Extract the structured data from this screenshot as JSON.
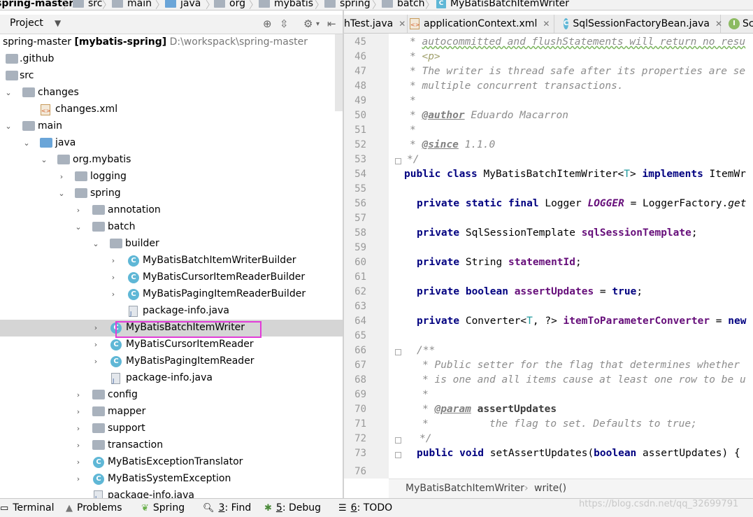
{
  "breadcrumb": [
    "spring-master",
    "src",
    "main",
    "java",
    "org",
    "mybatis",
    "spring",
    "batch",
    "MyBatisBatchItemWriter"
  ],
  "project_panel": {
    "title": "Project"
  },
  "tree": [
    {
      "label": "spring-master",
      "bold_suffix": "[mybatis-spring]",
      "path": "D:\\workspack\\spring-master",
      "type": "module"
    },
    {
      "label": ".github",
      "type": "folder"
    },
    {
      "label": "src",
      "type": "folder"
    },
    {
      "label": "changes",
      "type": "folder"
    },
    {
      "label": "changes.xml",
      "type": "xml"
    },
    {
      "label": "main",
      "type": "folder"
    },
    {
      "label": "java",
      "type": "folder-blue"
    },
    {
      "label": "org.mybatis",
      "type": "folder"
    },
    {
      "label": "logging",
      "type": "folder"
    },
    {
      "label": "spring",
      "type": "folder"
    },
    {
      "label": "annotation",
      "type": "folder"
    },
    {
      "label": "batch",
      "type": "folder"
    },
    {
      "label": "builder",
      "type": "folder"
    },
    {
      "label": "MyBatisBatchItemWriterBuilder",
      "type": "class"
    },
    {
      "label": "MyBatisCursorItemReaderBuilder",
      "type": "class"
    },
    {
      "label": "MyBatisPagingItemReaderBuilder",
      "type": "class"
    },
    {
      "label": "package-info.java",
      "type": "file"
    },
    {
      "label": "MyBatisBatchItemWriter",
      "type": "class"
    },
    {
      "label": "MyBatisCursorItemReader",
      "type": "class"
    },
    {
      "label": "MyBatisPagingItemReader",
      "type": "class"
    },
    {
      "label": "package-info.java",
      "type": "file"
    },
    {
      "label": "config",
      "type": "folder"
    },
    {
      "label": "mapper",
      "type": "folder"
    },
    {
      "label": "support",
      "type": "folder"
    },
    {
      "label": "transaction",
      "type": "folder"
    },
    {
      "label": "MyBatisExceptionTranslator",
      "type": "class"
    },
    {
      "label": "MyBatisSystemException",
      "type": "class"
    },
    {
      "label": "package-info.java",
      "type": "file"
    }
  ],
  "tabs": [
    "hTest.java",
    "applicationContext.xml",
    "SqlSessionFactoryBean.java",
    "Sc"
  ],
  "line_numbers": [
    "45",
    "46",
    "47",
    "48",
    "49",
    "50",
    "51",
    "52",
    "53",
    "54",
    "55",
    "56",
    "57",
    "58",
    "59",
    "60",
    "61",
    "62",
    "63",
    "64",
    "65",
    "66",
    "67",
    "68",
    "69",
    "70",
    "71",
    "72",
    "73",
    "76"
  ],
  "code": {
    "l45": "autocommitted and flushStatements will return no resu",
    "l46": "<p>",
    "l47": "The writer is thread safe after its properties are se",
    "l48": "multiple concurrent transactions.",
    "l50_tag": "@author",
    "l50_text": "Eduardo Macarron",
    "l52_tag": "@since",
    "l52_text": "1.1.0",
    "l54_kw": "public class",
    "l54_name": "MyBatisBatchItemWriter<",
    "l54_t": "T",
    "l54_rest": "> ",
    "l54_kw2": "implements",
    "l54_tail": "ItemWr",
    "l56_kw": "private static final",
    "l56_type": "Logger",
    "l56_field": "LOGGER",
    "l56_rest": "= LoggerFactory.",
    "l56_tail": "get",
    "l58_kw": "private",
    "l58_type": "SqlSessionTemplate",
    "l58_field": "sqlSessionTemplate",
    "l60_type": "String",
    "l60_field": "statementId",
    "l62_kw": "private boolean",
    "l62_field": "assertUpdates",
    "l62_rest": "= ",
    "l62_true": "true",
    "l64_type": "Converter<",
    "l64_t": "T",
    "l64_rest": ", ?>",
    "l64_field": "itemToParameterConverter",
    "l64_eq": "= ",
    "l64_new": "new",
    "l66": "/**",
    "l67": "* Public setter for the flag that determines whether",
    "l68": "* is one and all items cause at least one row to be u",
    "l69": "*",
    "l70_tag": "@param",
    "l70_name": "assertUpdates",
    "l71": "the flag to set. Defaults to true;",
    "l72": "*/",
    "l73_kw": "public void",
    "l73_name": "setAssertUpdates(",
    "l73_kw2": "boolean",
    "l73_rest": "assertUpdates) {"
  },
  "editor_breadcrumb": [
    "MyBatisBatchItemWriter",
    "write()"
  ],
  "bottom_tools": [
    {
      "key": "",
      "label": "Terminal"
    },
    {
      "key": "",
      "label": "Problems"
    },
    {
      "key": "",
      "label": "Spring"
    },
    {
      "key": "3",
      "label": ": Find"
    },
    {
      "key": "5",
      "label": ": Debug"
    },
    {
      "key": "6",
      "label": ": TODO"
    }
  ],
  "watermark": "https://blog.csdn.net/qq_32699791"
}
